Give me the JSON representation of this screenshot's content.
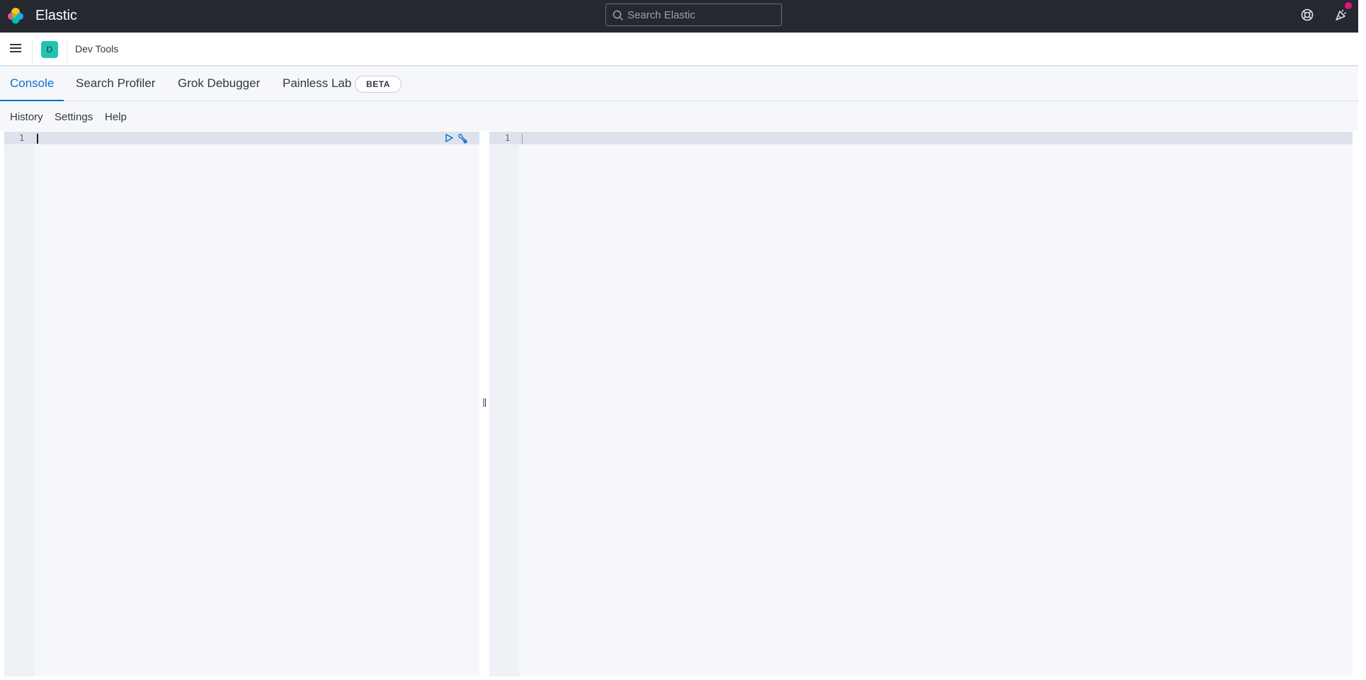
{
  "header": {
    "brand": "Elastic",
    "search_placeholder": "Search Elastic",
    "logo_icon": "elastic-logo-icon",
    "help_icon": "help-icon",
    "news_icon": "newsfeed-icon",
    "news_badge_color": "#e2147f"
  },
  "subheader": {
    "menu_icon": "hamburger-icon",
    "space_initial": "D",
    "space_color": "#24c2b5",
    "breadcrumb": "Dev Tools"
  },
  "tabs": [
    {
      "label": "Console",
      "active": true
    },
    {
      "label": "Search Profiler",
      "active": false
    },
    {
      "label": "Grok Debugger",
      "active": false
    },
    {
      "label": "Painless Lab",
      "active": false
    }
  ],
  "beta_badge": "BETA",
  "toolbar": {
    "history": "History",
    "settings": "Settings",
    "help": "Help"
  },
  "request_editor": {
    "line_number": "1",
    "run_icon": "play-icon",
    "wrench_icon": "wrench-icon"
  },
  "response_editor": {
    "line_number": "1"
  },
  "accent_color": "#0a6fc8"
}
